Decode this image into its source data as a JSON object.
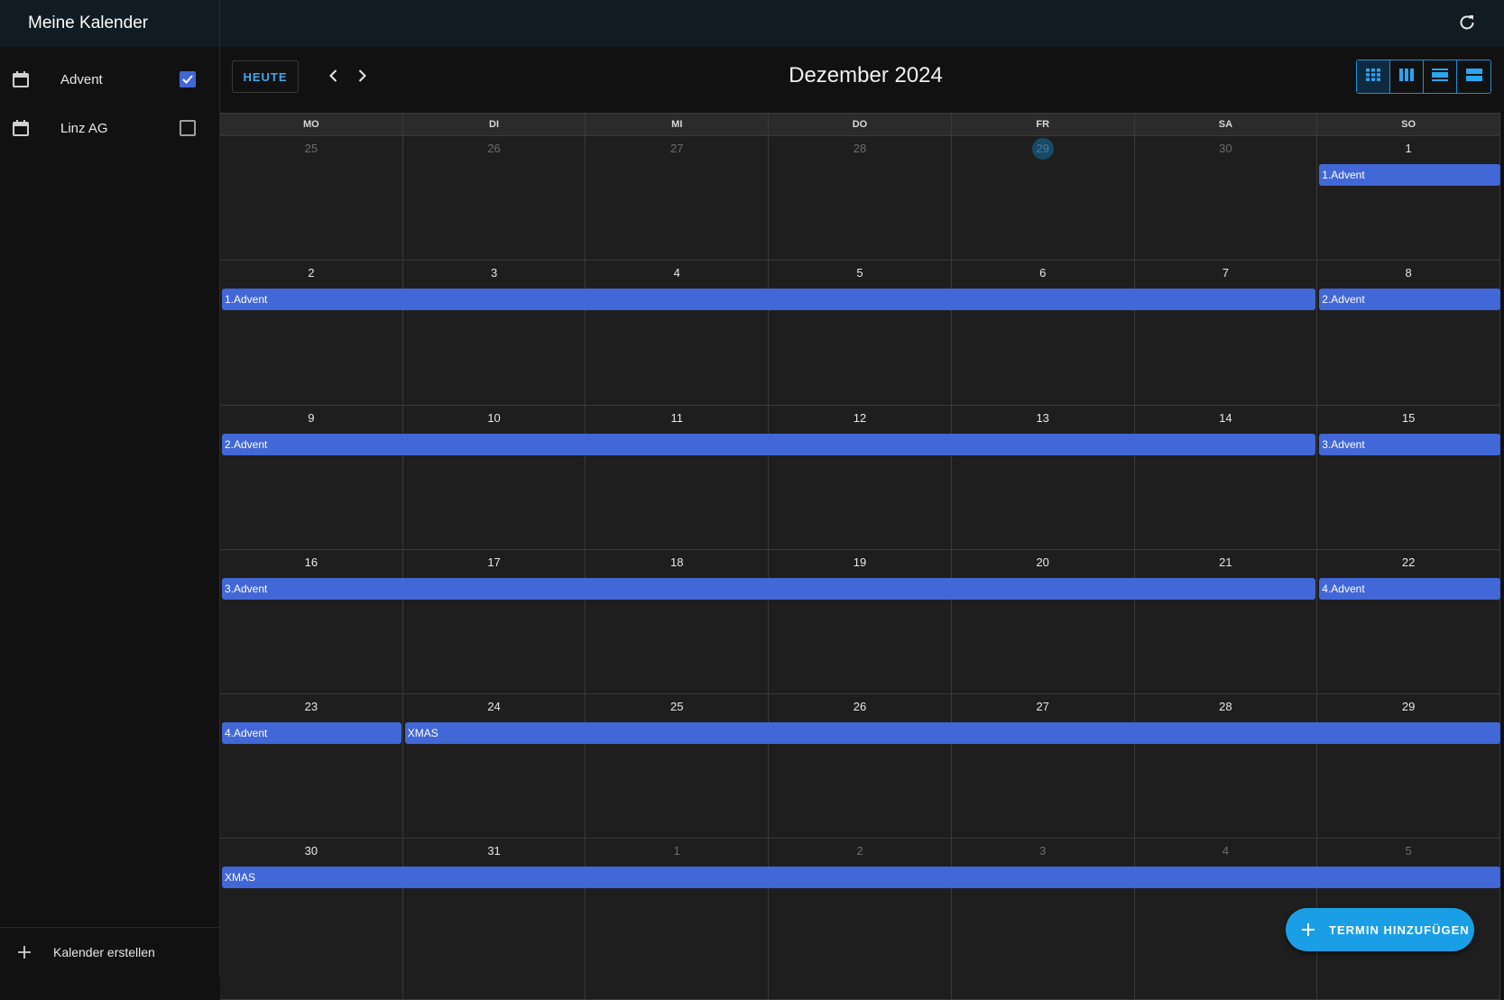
{
  "sidebar": {
    "title": "Meine Kalender",
    "calendars": [
      {
        "label": "Advent",
        "checked": true,
        "icon": "calendar-icon"
      },
      {
        "label": "Linz AG",
        "checked": false,
        "icon": "calendar-icon"
      }
    ],
    "create_label": "Kalender erstellen"
  },
  "toolbar": {
    "today_label": "HEUTE",
    "month_title": "Dezember 2024",
    "views": [
      "month-view-icon",
      "week-view-icon",
      "day-view-icon",
      "list-view-icon"
    ]
  },
  "calendar": {
    "weekdays": [
      "MO",
      "DI",
      "MI",
      "DO",
      "FR",
      "SA",
      "SO"
    ],
    "today": "29",
    "weeks": [
      {
        "days": [
          "25",
          "26",
          "27",
          "28",
          "29",
          "30",
          "1"
        ],
        "outside": [
          true,
          true,
          true,
          true,
          true,
          true,
          false
        ]
      },
      {
        "days": [
          "2",
          "3",
          "4",
          "5",
          "6",
          "7",
          "8"
        ],
        "outside": [
          false,
          false,
          false,
          false,
          false,
          false,
          false
        ]
      },
      {
        "days": [
          "9",
          "10",
          "11",
          "12",
          "13",
          "14",
          "15"
        ],
        "outside": [
          false,
          false,
          false,
          false,
          false,
          false,
          false
        ]
      },
      {
        "days": [
          "16",
          "17",
          "18",
          "19",
          "20",
          "21",
          "22"
        ],
        "outside": [
          false,
          false,
          false,
          false,
          false,
          false,
          false
        ]
      },
      {
        "days": [
          "23",
          "24",
          "25",
          "26",
          "27",
          "28",
          "29"
        ],
        "outside": [
          false,
          false,
          false,
          false,
          false,
          false,
          false
        ]
      },
      {
        "days": [
          "30",
          "31",
          "1",
          "2",
          "3",
          "4",
          "5"
        ],
        "outside": [
          false,
          false,
          true,
          true,
          true,
          true,
          true
        ]
      }
    ],
    "events": [
      {
        "title": "1.Advent",
        "week": 0,
        "start": 6,
        "span": 1
      },
      {
        "title": "1.Advent",
        "week": 1,
        "start": 0,
        "span": 6
      },
      {
        "title": "2.Advent",
        "week": 1,
        "start": 6,
        "span": 1
      },
      {
        "title": "2.Advent",
        "week": 2,
        "start": 0,
        "span": 6
      },
      {
        "title": "3.Advent",
        "week": 2,
        "start": 6,
        "span": 1
      },
      {
        "title": "3.Advent",
        "week": 3,
        "start": 0,
        "span": 6
      },
      {
        "title": "4.Advent",
        "week": 3,
        "start": 6,
        "span": 1
      },
      {
        "title": "4.Advent",
        "week": 4,
        "start": 0,
        "span": 1
      },
      {
        "title": "XMAS",
        "week": 4,
        "start": 1,
        "span": 6
      },
      {
        "title": "XMAS",
        "week": 5,
        "start": 0,
        "span": 7
      }
    ]
  },
  "fab": {
    "label": "TERMIN HINZUFÜGEN"
  },
  "colors": {
    "accent": "#1a9fe6",
    "event": "#4267d6",
    "header": "#101b22"
  }
}
